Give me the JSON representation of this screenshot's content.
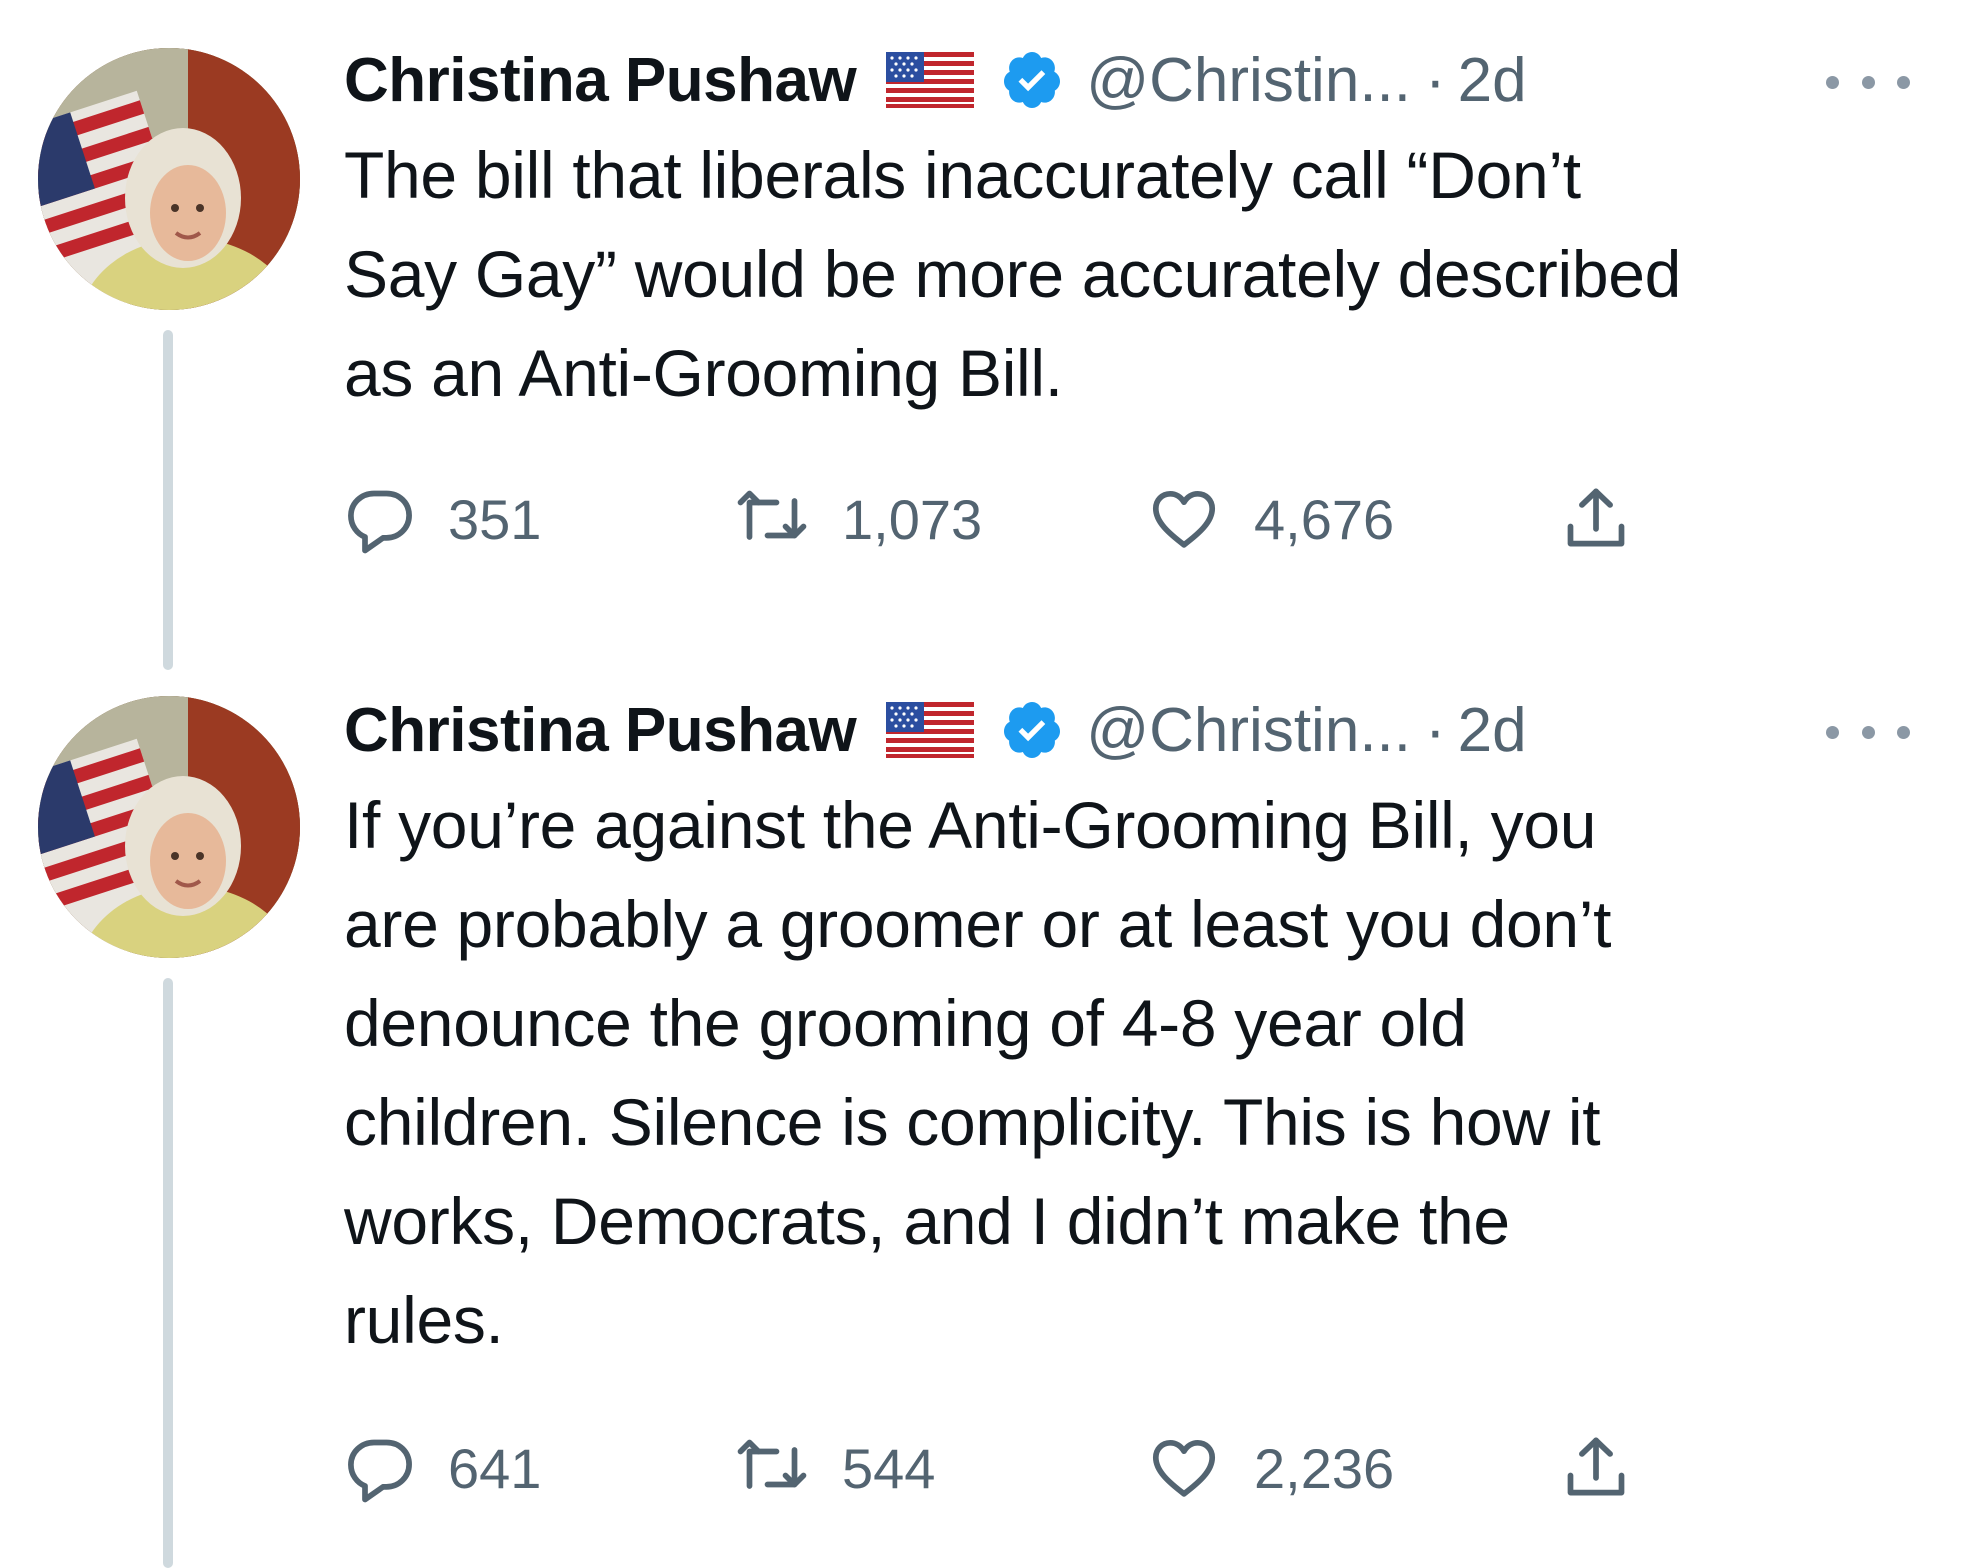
{
  "tweets": [
    {
      "author": {
        "display_name": "Christina Pushaw",
        "flag_icon": "us-flag-icon",
        "verified_icon": "verified-badge-icon",
        "handle": "@Christin...",
        "separator": "·",
        "time": "2d"
      },
      "text_lines": [
        "The bill that liberals inaccurately call “Don’t",
        "Say Gay” would be more accurately described",
        "as an Anti-Grooming Bill."
      ],
      "stats": {
        "replies": "351",
        "retweets": "1,073",
        "likes": "4,676"
      }
    },
    {
      "author": {
        "display_name": "Christina Pushaw",
        "flag_icon": "us-flag-icon",
        "verified_icon": "verified-badge-icon",
        "handle": "@Christin...",
        "separator": "·",
        "time": "2d"
      },
      "text_lines": [
        "If you’re against the Anti-Grooming Bill, you",
        "are probably a groomer or at least you don’t",
        "denounce the grooming of 4-8 year old",
        "children. Silence is complicity. This is how it",
        "works, Democrats, and I didn’t make the",
        "rules."
      ],
      "stats": {
        "replies": "641",
        "retweets": "544",
        "likes": "2,236"
      }
    }
  ],
  "colors": {
    "text_primary": "#0f1419",
    "text_secondary": "#536471",
    "verified_blue": "#1d9bf0",
    "thread_line": "#cfd9de"
  }
}
